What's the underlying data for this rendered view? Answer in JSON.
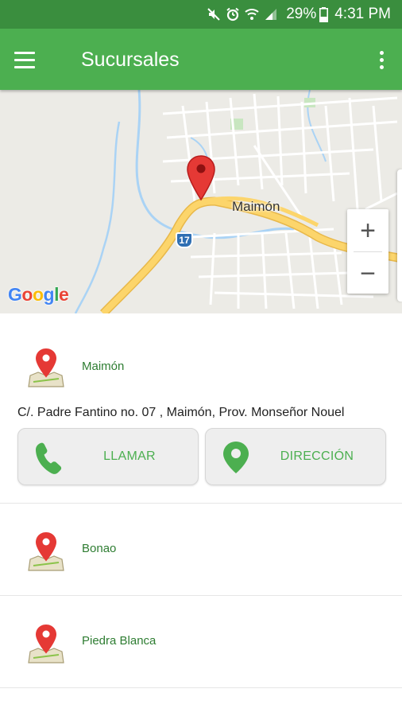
{
  "status_bar": {
    "battery": "29%",
    "time": "4:31 PM",
    "icons": [
      "mute-icon",
      "alarm-icon",
      "wifi-icon",
      "signal-icon",
      "battery-icon"
    ]
  },
  "app_bar": {
    "title": "Sucursales",
    "icons": [
      "menu-icon",
      "overflow-menu-icon"
    ]
  },
  "map": {
    "place_label": "Maimón",
    "route_number": "17",
    "zoom_in": "+",
    "zoom_out": "−",
    "logo_text": "Google",
    "colors": {
      "road": "#fcd56b",
      "water": "#aad3f5",
      "park": "#c8e6c0",
      "marker": "#e53935"
    }
  },
  "branches": [
    {
      "name": "Maimón",
      "expanded": true,
      "address": "C/. Padre Fantino no. 07 , Maimón, Prov. Monseñor Nouel",
      "call_label": "LLAMAR",
      "directions_label": "DIRECCIÓN"
    },
    {
      "name": "Bonao",
      "expanded": false
    },
    {
      "name": "Piedra Blanca",
      "expanded": false
    }
  ],
  "colors": {
    "status_bar": "#3a8e3e",
    "app_bar": "#4caf50",
    "accent_green": "#4caf50",
    "branch_name": "#2e7d32"
  }
}
